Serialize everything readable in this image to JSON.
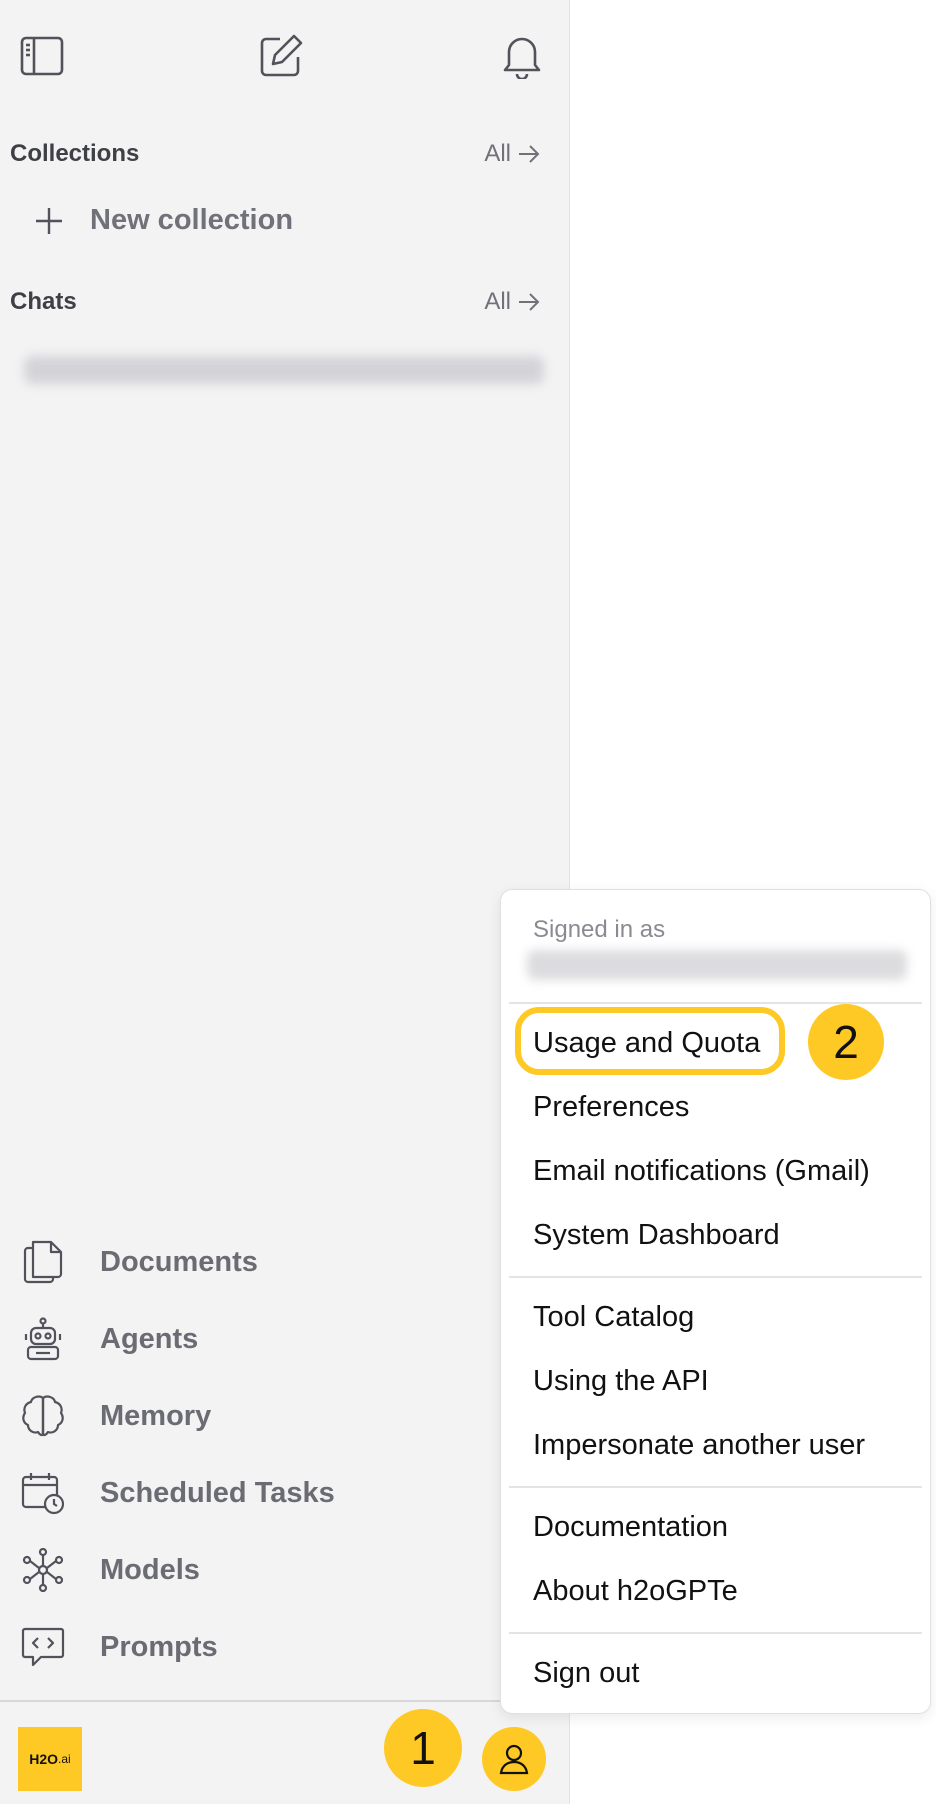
{
  "sidebar": {
    "collections_title": "Collections",
    "chats_title": "Chats",
    "all_label": "All",
    "new_collection_label": "New collection",
    "nav": [
      {
        "label": "Documents",
        "icon": "documents-icon"
      },
      {
        "label": "Agents",
        "icon": "robot-icon"
      },
      {
        "label": "Memory",
        "icon": "brain-icon"
      },
      {
        "label": "Scheduled Tasks",
        "icon": "calendar-clock-icon"
      },
      {
        "label": "Models",
        "icon": "network-icon"
      },
      {
        "label": "Prompts",
        "icon": "code-bubble-icon"
      }
    ],
    "logo_text": "H2O",
    "logo_suffix": ".ai"
  },
  "menu": {
    "signed_in_caption": "Signed in as",
    "items": [
      "Usage and Quota",
      "Preferences",
      "Email notifications (Gmail)",
      "System Dashboard",
      "Tool Catalog",
      "Using the API",
      "Impersonate another user",
      "Documentation",
      "About h2oGPTe",
      "Sign out"
    ]
  },
  "annotations": {
    "step1": "1",
    "step2": "2"
  },
  "colors": {
    "accent": "#fec925",
    "sidebar_bg": "#f3f3f4",
    "muted_text": "#71717a"
  }
}
